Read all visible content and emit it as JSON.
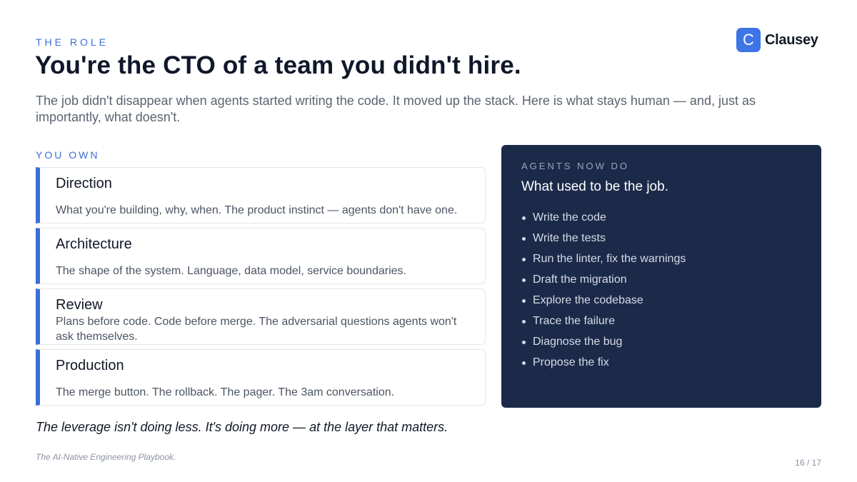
{
  "header": {
    "eyebrow": "THE ROLE",
    "title": "You're the CTO of a team you didn't hire.",
    "subtitle": "The job didn't disappear when agents started writing the code. It moved up the stack. Here is what stays human — and, just as importantly, what doesn't."
  },
  "logo": {
    "mark": "C",
    "name": "Clausey",
    "color": "#3d74e6"
  },
  "you_own": {
    "label": "YOU OWN",
    "accent": "#3a6fd8",
    "cards": [
      {
        "title": "Direction",
        "desc": "What you're building, why, when. The product instinct — agents don't have one."
      },
      {
        "title": "Architecture",
        "desc": "The shape of the system. Language, data model, service boundaries."
      },
      {
        "title": "Review",
        "desc": "Plans before code. Code before merge. The adversarial questions agents won't ask themselves."
      },
      {
        "title": "Production",
        "desc": "The merge button. The rollback. The pager. The 3am conversation."
      }
    ]
  },
  "agents": {
    "eyebrow": "AGENTS NOW DO",
    "title": "What used to be the job.",
    "background": "#1c2a4a",
    "items": [
      "Write the code",
      "Write the tests",
      "Run the linter, fix the warnings",
      "Draft the migration",
      "Explore the codebase",
      "Trace the failure",
      "Diagnose the bug",
      "Propose the fix"
    ]
  },
  "tagline": "The leverage isn't doing less. It's doing more — at the layer that matters.",
  "footer": {
    "source": "The AI-Native Engineering Playbook.",
    "page": "16 / 17"
  }
}
